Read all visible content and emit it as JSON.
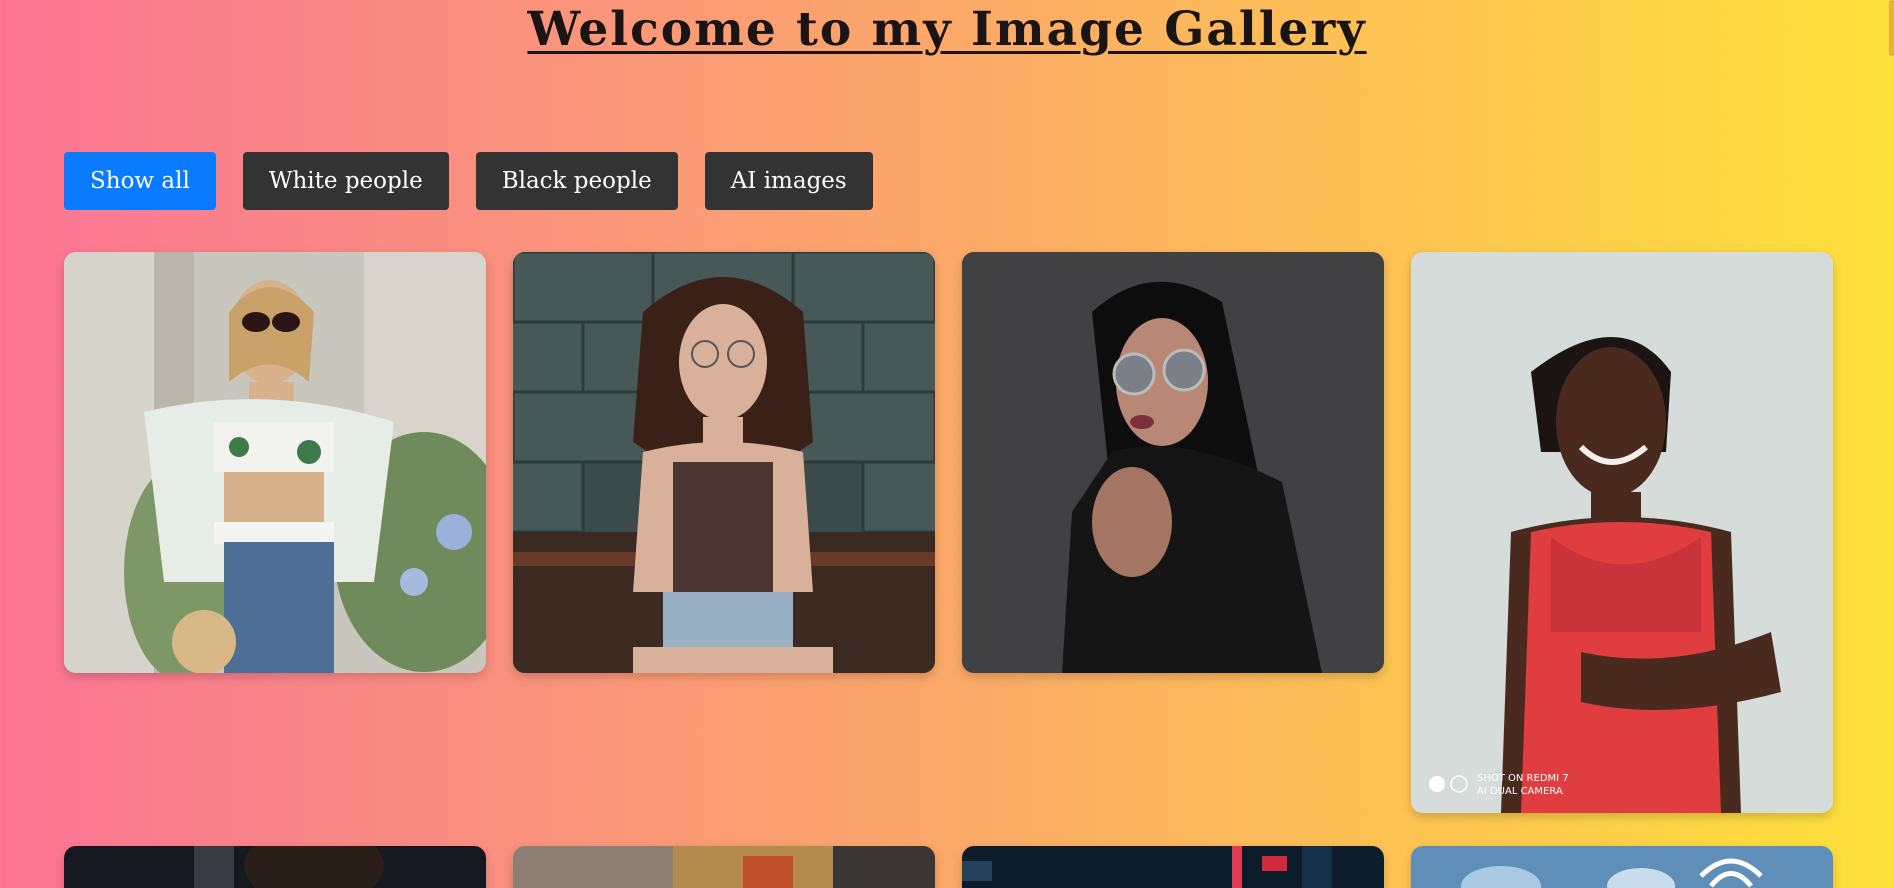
{
  "page": {
    "title": "Welcome to my Image Gallery"
  },
  "filters": [
    {
      "label": "Show all",
      "active": true
    },
    {
      "label": "White people",
      "active": false
    },
    {
      "label": "Black people",
      "active": false
    },
    {
      "label": "AI images",
      "active": false
    }
  ],
  "gallery": {
    "card4_watermark_line1": "SHOT ON REDMI 7",
    "card4_watermark_line2": "AI DUAL CAMERA"
  },
  "colors": {
    "active_button": "#0a7bff",
    "button": "#333333",
    "gradient_start": "#fb7495",
    "gradient_end": "#fee13a"
  }
}
